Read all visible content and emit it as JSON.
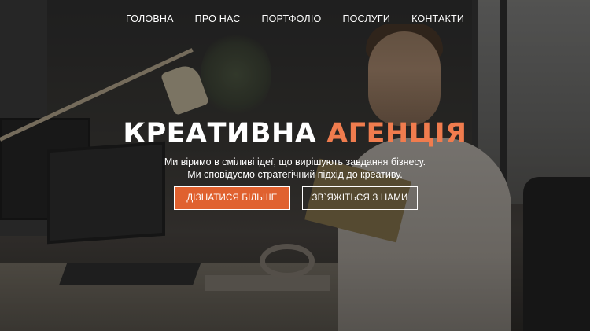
{
  "nav": {
    "items": [
      {
        "label": "ГОЛОВНА"
      },
      {
        "label": "ПРО НАС"
      },
      {
        "label": "ПОРТФОЛІО"
      },
      {
        "label": "ПОСЛУГИ"
      },
      {
        "label": "КОНТАКТИ"
      }
    ]
  },
  "hero": {
    "title_main": "КРЕАТИВНА",
    "title_accent": "АГЕНЦІЯ",
    "subtitle_line1": "Ми віримо в сміливі ідеї, що вирішують завдання бізнесу.",
    "subtitle_line2": "Ми сповідуємо стратегічний підхід до креативу.",
    "primary_button": "ДІЗНАТИСЯ БІЛЬШЕ",
    "secondary_button": "ЗВ`ЯЖІТЬСЯ З НАМИ"
  },
  "colors": {
    "accent": "#f07c4e",
    "button_primary": "#e0612f",
    "text": "#ffffff"
  }
}
